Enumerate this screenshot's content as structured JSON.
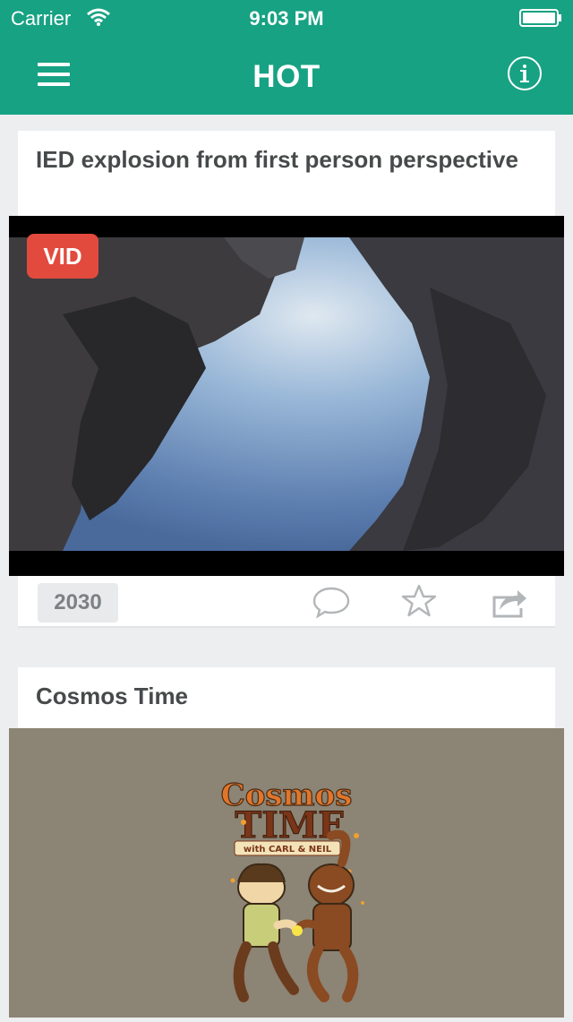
{
  "status_bar": {
    "carrier": "Carrier",
    "time": "9:03 PM"
  },
  "nav": {
    "title": "HOT",
    "menu_icon": "hamburger-menu-icon",
    "info_icon": "info-icon"
  },
  "posts": [
    {
      "title": "IED explosion from first person perspective",
      "badge": "VID",
      "votes": "2030"
    },
    {
      "title": "Cosmos Time",
      "image_text": {
        "line1": "Cosmos",
        "line2": "TIME",
        "line3": "with CARL & NEIL"
      }
    }
  ],
  "colors": {
    "header": "#17a283",
    "badge": "#e24a3e",
    "background": "#eceeef"
  }
}
